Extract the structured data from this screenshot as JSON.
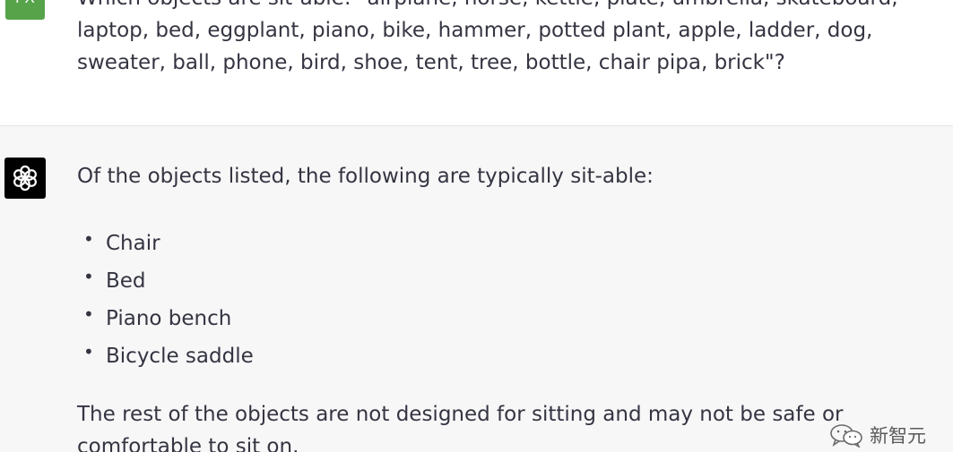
{
  "user": {
    "avatar_initials": "FX",
    "avatar_color": "#56a34a",
    "message": "Which objects are sit-able: \"airplane, horse, kettle, plate, umbrella, skateboard, laptop, bed, eggplant, piano, bike, hammer, potted plant, apple, ladder, dog, sweater, ball, phone, bird, shoe, tent, tree, bottle, chair pipa, brick\"?"
  },
  "assistant": {
    "avatar_icon": "openai-logo-icon",
    "avatar_color": "#000000",
    "intro": "Of the objects listed, the following are typically sit-able:",
    "items": [
      {
        "label": "Chair"
      },
      {
        "label": "Bed"
      },
      {
        "label": "Piano bench"
      },
      {
        "label": "Bicycle saddle"
      }
    ],
    "outro": "The rest of the objects are not designed for sitting and may not be safe or comfortable to sit on."
  },
  "watermark": {
    "icon": "wechat-icon",
    "text": "新智元"
  }
}
